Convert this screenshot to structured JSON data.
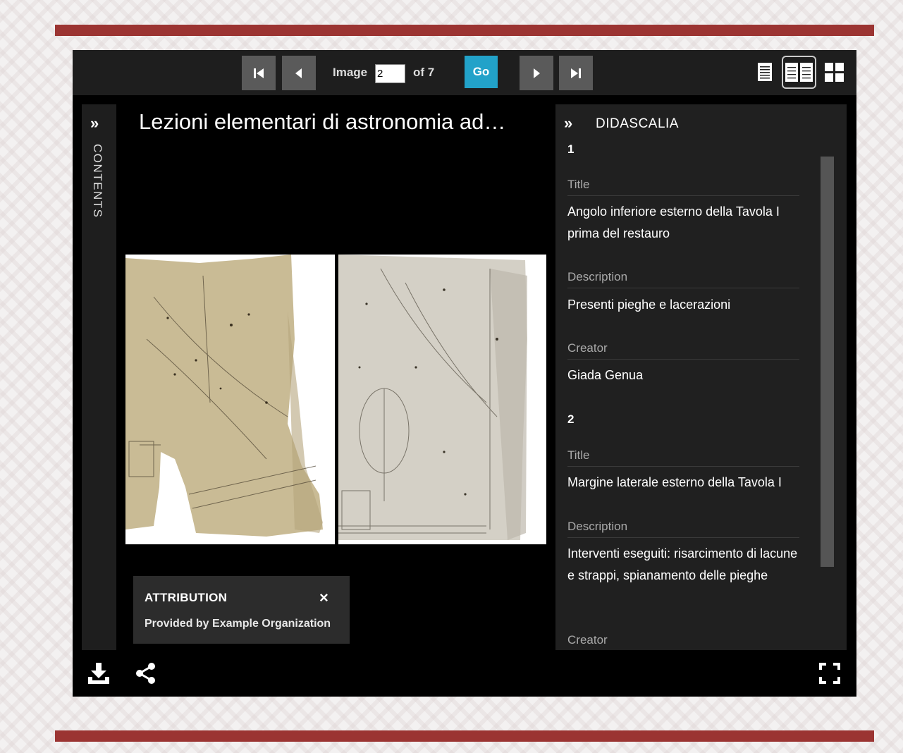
{
  "toolbar": {
    "image_label": "Image",
    "image_value": "2",
    "of_label": "of 7",
    "go_label": "Go"
  },
  "contents_panel": {
    "chevron": "»",
    "label": "CONTENTS"
  },
  "main": {
    "title": "Lezioni elementari di astronomia ad…"
  },
  "attribution": {
    "heading": "ATTRIBUTION",
    "close": "×",
    "text": "Provided by Example Organization"
  },
  "didascalia": {
    "chevron": "»",
    "title": "DIDASCALIA",
    "items": [
      {
        "number": "1",
        "title_label": "Title",
        "title_value": "Angolo inferiore esterno della Tavola I prima del restauro",
        "description_label": "Description",
        "description_value": "Presenti pieghe e lacerazioni",
        "creator_label": "Creator",
        "creator_value": "Giada Genua"
      },
      {
        "number": "2",
        "title_label": "Title",
        "title_value": "Margine laterale esterno della Tavola I",
        "description_label": "Description",
        "description_value": "Interventi eseguiti: risarcimento di lacune e strappi, spianamento delle pieghe",
        "creator_label": "Creator"
      }
    ]
  },
  "icons": {
    "first": "first-page-icon",
    "prev": "previous-page-icon",
    "next": "next-page-icon",
    "last": "last-page-icon",
    "single_view": "single-page-view-icon",
    "book_view": "book-view-icon",
    "gallery_view": "gallery-view-icon",
    "download": "download-icon",
    "share": "share-icon",
    "fullscreen": "fullscreen-icon"
  },
  "colors": {
    "accent_band": "#9b3432",
    "go_button": "#22a2c9",
    "viewer_bg": "#000000",
    "panel_bg": "#202020"
  }
}
